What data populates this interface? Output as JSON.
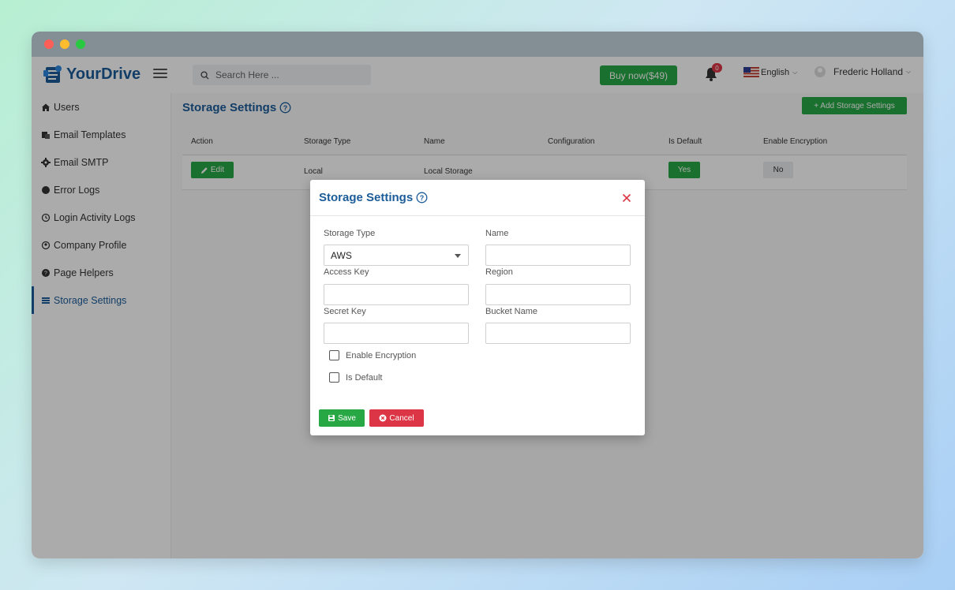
{
  "app": {
    "name": "YourDrive",
    "brand_color": "#1c5c99",
    "accent_color": "#28a745",
    "danger_color": "#dc3545"
  },
  "header": {
    "search_placeholder": "Search Here ...",
    "buy_label": "Buy now($49)",
    "notification_count": "0",
    "language": "English",
    "user_name": "Frederic Holland"
  },
  "sidebar": {
    "items": [
      {
        "label": "Users",
        "icon": "home-icon"
      },
      {
        "label": "Email Templates",
        "icon": "email-templates-icon"
      },
      {
        "label": "Email SMTP",
        "icon": "gear-icon"
      },
      {
        "label": "Error Logs",
        "icon": "globe-icon"
      },
      {
        "label": "Login Activity Logs",
        "icon": "history-icon"
      },
      {
        "label": "Company Profile",
        "icon": "user-circle-icon"
      },
      {
        "label": "Page Helpers",
        "icon": "question-circle-icon"
      },
      {
        "label": "Storage Settings",
        "icon": "list-icon",
        "active": true
      }
    ]
  },
  "page": {
    "title": "Storage Settings",
    "add_button": "+ Add Storage Settings",
    "table": {
      "headers": [
        "Action",
        "Storage Type",
        "Name",
        "Configuration",
        "Is Default",
        "Enable Encryption"
      ],
      "rows": [
        {
          "action": "Edit",
          "storage_type": "Local",
          "name": "Local Storage",
          "configuration": "",
          "is_default": "Yes",
          "enable_encryption": "No"
        }
      ]
    }
  },
  "modal": {
    "title": "Storage Settings",
    "fields": {
      "storage_type": {
        "label": "Storage Type",
        "value": "AWS"
      },
      "name": {
        "label": "Name",
        "value": ""
      },
      "access_key": {
        "label": "Access Key",
        "value": ""
      },
      "region": {
        "label": "Region",
        "value": ""
      },
      "secret_key": {
        "label": "Secret Key",
        "value": ""
      },
      "bucket_name": {
        "label": "Bucket Name",
        "value": ""
      }
    },
    "checkboxes": {
      "enable_encryption": {
        "label": "Enable Encryption",
        "checked": false
      },
      "is_default": {
        "label": "Is Default",
        "checked": false
      }
    },
    "save_label": "Save",
    "cancel_label": "Cancel"
  }
}
